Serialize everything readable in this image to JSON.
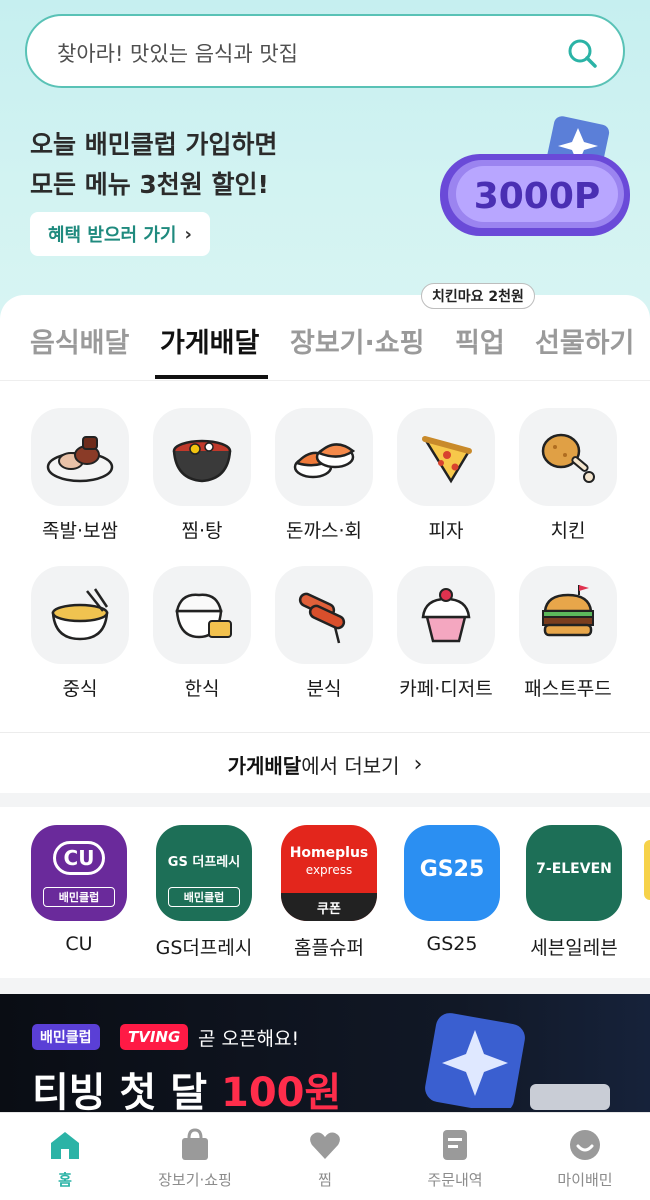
{
  "search": {
    "placeholder": "찾아라! 맛있는 음식과 맛집"
  },
  "promo": {
    "line1": "오늘 배민클럽 가입하면",
    "line2": "모든 메뉴 3천원 할인!",
    "button_label": "혜택 받으러 가기",
    "coin_label": "3000P"
  },
  "tabs": [
    {
      "label": "음식배달",
      "active": false
    },
    {
      "label": "가게배달",
      "active": true
    },
    {
      "label": "장보기·쇼핑",
      "active": false
    },
    {
      "label": "픽업",
      "active": false
    },
    {
      "label": "선물하기",
      "active": false
    }
  ],
  "tab_badge": "치킨마요 2천원",
  "categories": [
    {
      "label": "족발·보쌈",
      "icon": "jokbal-icon"
    },
    {
      "label": "찜·탕",
      "icon": "stew-icon"
    },
    {
      "label": "돈까스·회",
      "icon": "sushi-icon"
    },
    {
      "label": "피자",
      "icon": "pizza-icon"
    },
    {
      "label": "치킨",
      "icon": "chicken-icon"
    },
    {
      "label": "중식",
      "icon": "noodles-icon"
    },
    {
      "label": "한식",
      "icon": "rice-icon"
    },
    {
      "label": "분식",
      "icon": "tteokbokki-icon"
    },
    {
      "label": "카페·디저트",
      "icon": "cupcake-icon"
    },
    {
      "label": "패스트푸드",
      "icon": "burger-icon"
    }
  ],
  "more": {
    "bold": "가게배달",
    "rest": "에서 더보기"
  },
  "shops": [
    {
      "name": "CU",
      "logo_text": "CU",
      "sub": "배민클럽",
      "color": "#6a2a9b"
    },
    {
      "name": "GS더프레시",
      "logo_text": "GS 더프레시",
      "sub": "배민클럽",
      "color": "#1d6f57"
    },
    {
      "name": "홈플슈퍼",
      "logo_text": "Homeplus",
      "logo_sub": "express",
      "sub": "쿠폰",
      "color": "#e3261c"
    },
    {
      "name": "GS25",
      "logo_text": "GS25",
      "color": "#2b8ff2"
    },
    {
      "name": "세븐일레븐",
      "logo_text": "7-ELEVEN",
      "color": "#1d6f57"
    }
  ],
  "banner": {
    "club": "배민클럽",
    "tving": "TVING",
    "open_text": "곧 오픈해요!",
    "big_prefix": "티빙 첫 달 ",
    "big_red": "100원"
  },
  "nav": [
    {
      "label": "홈",
      "icon": "home-icon",
      "active": true
    },
    {
      "label": "장보기·쇼핑",
      "icon": "shopping-bag-icon",
      "active": false
    },
    {
      "label": "찜",
      "icon": "heart-icon",
      "active": false
    },
    {
      "label": "주문내역",
      "icon": "receipt-icon",
      "active": false
    },
    {
      "label": "마이배민",
      "icon": "smile-icon",
      "active": false
    }
  ],
  "colors": {
    "accent": "#2bb3a6",
    "hero_bg": "#c6eff0"
  }
}
